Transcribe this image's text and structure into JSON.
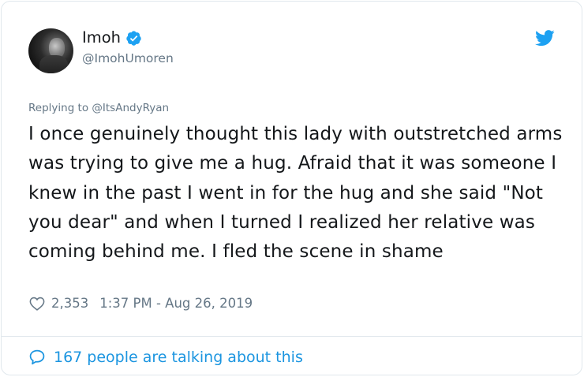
{
  "author": {
    "display_name": "Imoh",
    "handle": "@ImohUmoren",
    "verified": true,
    "avatar_icon": "avatar-photo-icon"
  },
  "reply": {
    "prefix": "Replying to ",
    "to": "@ItsAndyRyan"
  },
  "tweet": {
    "text": "I once genuinely thought this lady with outstretched arms was trying to give me a hug. Afraid that it was someone I knew in the past I went in for the hug and she said \"Not you dear\" and when I turned I realized her relative was coming behind me. I fled the scene in shame"
  },
  "meta": {
    "likes": "2,353",
    "timestamp": "1:37 PM - Aug 26, 2019"
  },
  "footer": {
    "talking": "167 people are talking about this"
  },
  "colors": {
    "brand_blue": "#1da1f2",
    "link_blue": "#1b95e0",
    "secondary_text": "#657786",
    "border": "#e1e8ed"
  }
}
